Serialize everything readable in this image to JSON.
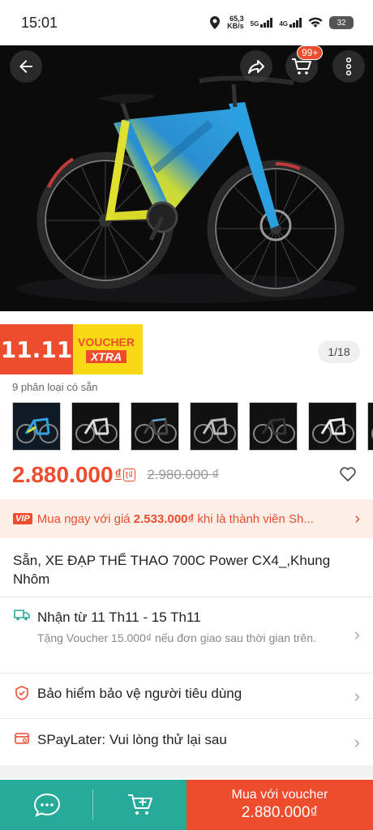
{
  "status_bar": {
    "time": "15:01",
    "net_speed": "65,3",
    "net_unit": "KB/s",
    "net_5g": "5G",
    "net_4g": "4G",
    "battery": "32"
  },
  "header": {
    "cart_badge": "99+"
  },
  "gallery": {
    "page_indicator": "1/18",
    "promo_1111": "11.11",
    "promo_voucher": "VOUCHER",
    "promo_xtra": "XTRA"
  },
  "variants": {
    "label": "9 phân loại có sẵn"
  },
  "price": {
    "current": "2.880.000",
    "currency": "₫",
    "tag": "t₫",
    "original": "2.980.000 ₫"
  },
  "vip": {
    "badge": "VIP",
    "text_before": "Mua ngay với giá ",
    "vip_price": "2.533.000₫",
    "text_after": " khi là thành viên Sh..."
  },
  "product": {
    "title": "Sẵn, XE ĐẠP THỂ THAO 700C Power CX4_,Khung Nhôm"
  },
  "shipping": {
    "main": "Nhận từ 11 Th11 - 15 Th11",
    "sub": "Tặng Voucher 15.000₫ nếu đơn giao sau thời gian trên."
  },
  "insurance": {
    "main": "Bảo hiểm bảo vệ người tiêu dùng"
  },
  "spaylater": {
    "main": "SPayLater: Vui lòng thử lại sau"
  },
  "bottom": {
    "buy_label": "Mua với voucher",
    "buy_price": "2.880.000₫"
  },
  "colors": {
    "accent": "#ee4d2d",
    "teal": "#26aa99"
  }
}
